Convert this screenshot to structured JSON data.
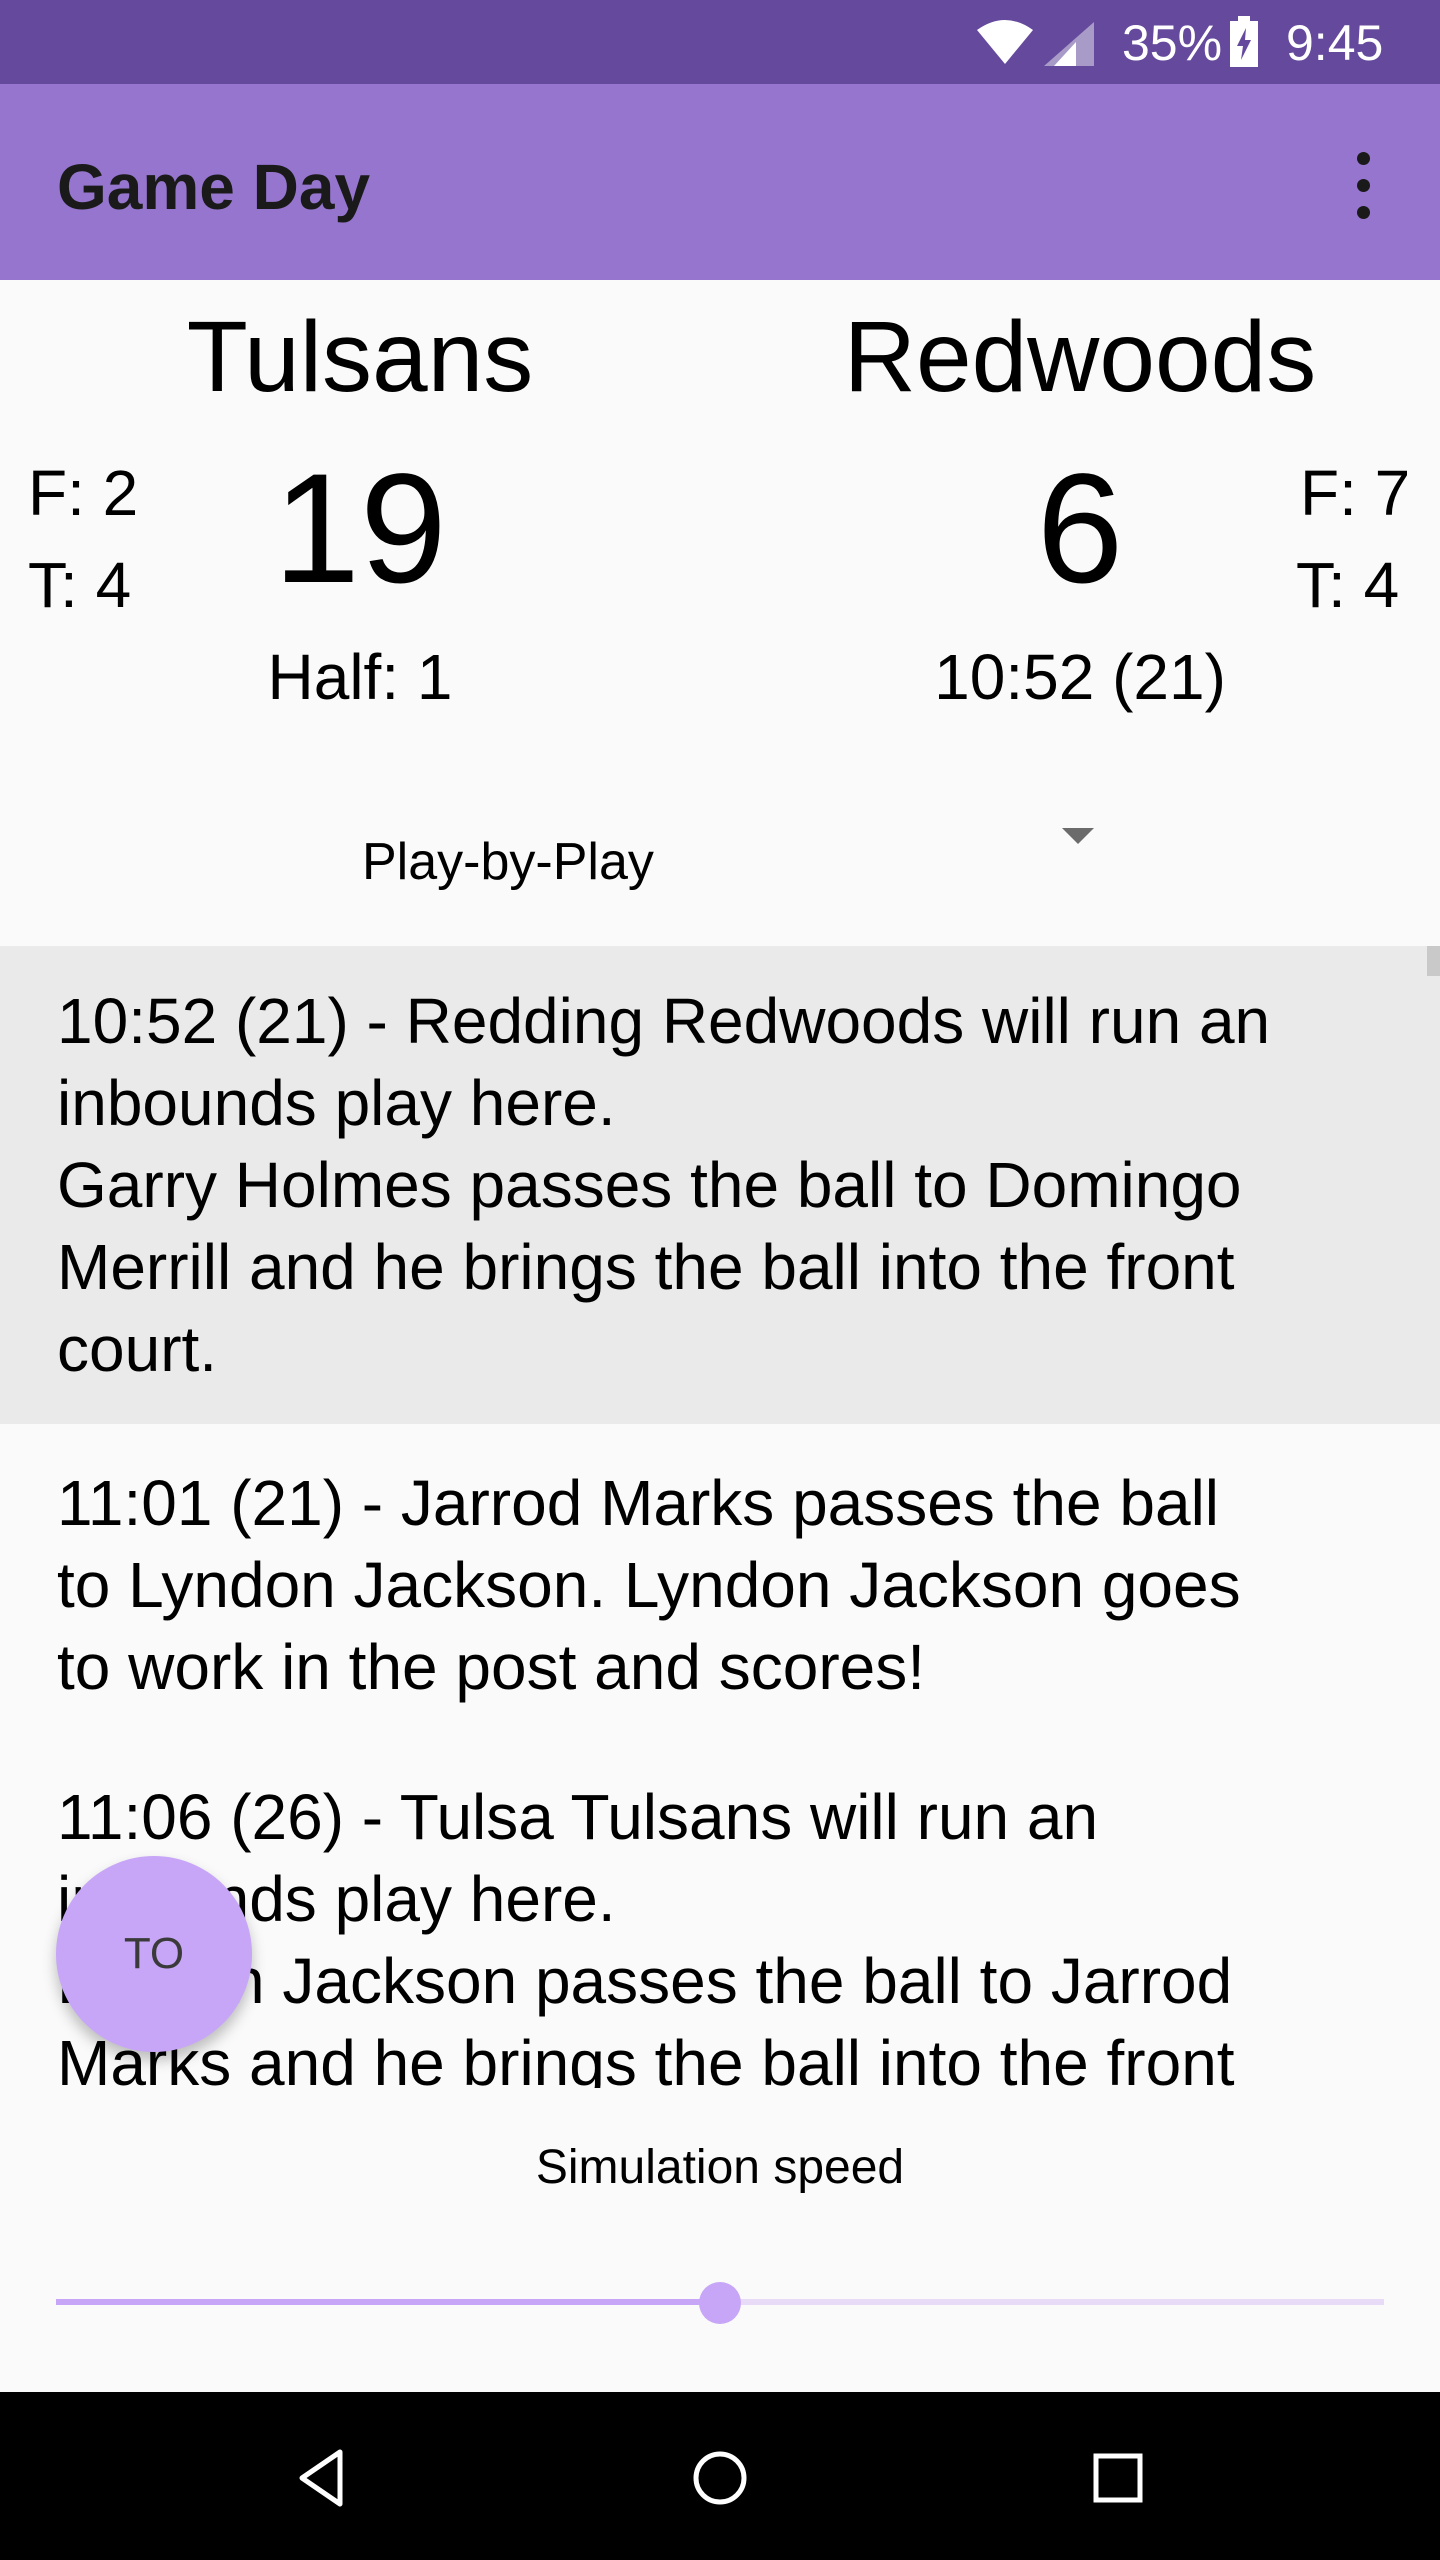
{
  "status_bar": {
    "battery": "35%",
    "time": "9:45",
    "icons": [
      "wifi-icon",
      "cell-signal-icon",
      "battery-charging-icon"
    ]
  },
  "app_bar": {
    "title": "Game Day",
    "menu_icon": "more-vert-icon"
  },
  "home_team": {
    "name": "Tulsans",
    "fouls": "F: 2",
    "timeouts": "T: 4",
    "score": "19",
    "info": "Half: 1"
  },
  "away_team": {
    "name": "Redwoods",
    "fouls": "F: 7",
    "timeouts": "T: 4",
    "score": "6",
    "info": "10:52 (21)"
  },
  "view_selector": {
    "selected": "Play-by-Play",
    "icon": "dropdown-arrow-icon"
  },
  "play_by_play": [
    {
      "lines": [
        "10:52 (21) - Redding Redwoods will run an",
        "inbounds play here.",
        "Garry Holmes passes the ball to Domingo",
        "Merrill and he brings the ball into the front",
        "court."
      ]
    },
    {
      "lines": [
        "11:01 (21) - Jarrod Marks passes the ball",
        "to Lyndon Jackson. Lyndon Jackson goes",
        "to work in the post and scores!"
      ]
    },
    {
      "lines": [
        "11:06 (26) - Tulsa Tulsans will run an",
        "inbounds play here.",
        "Lyndon Jackson passes the ball to Jarrod",
        "Marks and he brings the ball into the front"
      ]
    }
  ],
  "timeout_button": {
    "label": "TO"
  },
  "simulation": {
    "label": "Simulation speed",
    "value_fraction": 0.5
  },
  "colors": {
    "status_bar": "#65499C",
    "app_bar": "#9575CD",
    "accent": "#C7A6F7"
  },
  "nav_bar": {
    "icons": [
      "back-icon",
      "home-icon",
      "recents-icon"
    ]
  }
}
